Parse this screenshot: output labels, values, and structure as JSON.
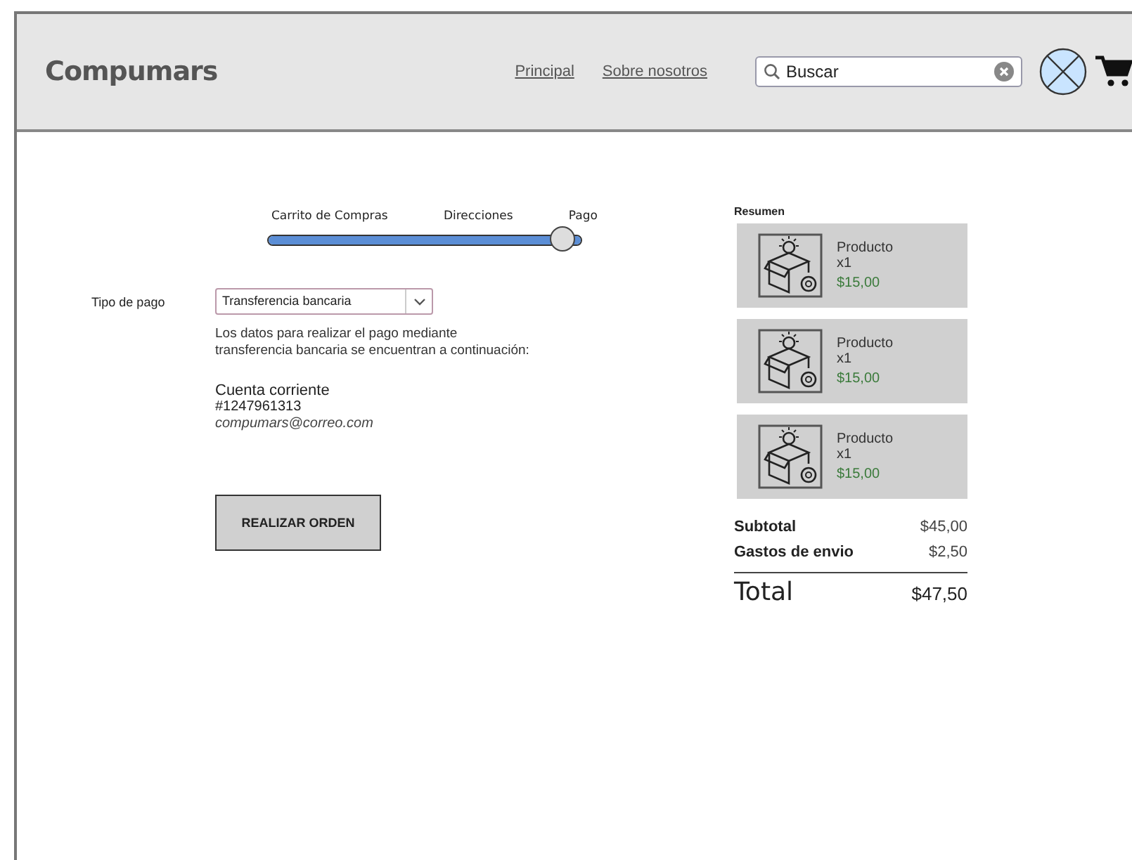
{
  "header": {
    "logo": "Compumars",
    "nav": [
      {
        "label": "Principal"
      },
      {
        "label": "Sobre nosotros"
      }
    ],
    "search": {
      "value": "Buscar"
    }
  },
  "stepper": {
    "steps": [
      "Carrito de Compras",
      "Direcciones",
      "Pago"
    ],
    "level": 1
  },
  "payment": {
    "label": "Tipo de pago",
    "selected_option": "Transferencia bancaria",
    "info": "Los datos para realizar el pago mediante\ntransferencia bancaria se encuentran a continuación:",
    "account_type": "Cuenta corriente",
    "account_number": "#1247961313",
    "email": "compumars@correo.com",
    "button": "REALIZAR ORDEN"
  },
  "summary": {
    "title": "Resumen",
    "items": [
      {
        "name": "Producto",
        "qty": "x1",
        "price": "$15,00"
      },
      {
        "name": "Producto",
        "qty": "x1",
        "price": "$15,00"
      },
      {
        "name": "Producto",
        "qty": "x1",
        "price": "$15,00"
      }
    ],
    "subtotal_label": "Subtotal",
    "subtotal": "$45,00",
    "shipping_label": "Gastos de envio",
    "shipping": "$2,50",
    "total_label": "Total",
    "total": "$47,50"
  }
}
